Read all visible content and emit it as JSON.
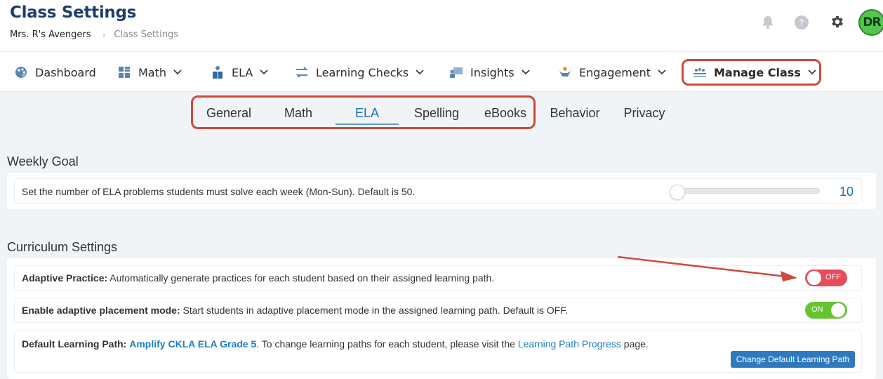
{
  "header": {
    "title": "Class Settings",
    "breadcrumb": {
      "class_name": "Mrs. R's Avengers",
      "separator": "›",
      "current": "Class Settings"
    },
    "help_glyph": "?",
    "avatar_initials": "DR"
  },
  "main_nav": {
    "items": [
      {
        "label": "Dashboard",
        "icon": "palette-icon"
      },
      {
        "label": "Math",
        "icon": "grid-icon"
      },
      {
        "label": "ELA",
        "icon": "reader-icon"
      },
      {
        "label": "Learning Checks",
        "icon": "swap-arrows-icon"
      },
      {
        "label": "Insights",
        "icon": "presentation-icon"
      },
      {
        "label": "Engagement",
        "icon": "hands-icon"
      },
      {
        "label": "Manage Class",
        "icon": "group-icon"
      }
    ]
  },
  "sub_tabs": {
    "items": [
      "General",
      "Math",
      "ELA",
      "Spelling",
      "eBooks",
      "Behavior",
      "Privacy"
    ],
    "active": "ELA"
  },
  "weekly_goal": {
    "title": "Weekly Goal",
    "description": "Set the number of ELA problems students must solve each week (Mon-Sun). Default is 50.",
    "value": "10"
  },
  "curriculum": {
    "title": "Curriculum Settings",
    "adaptive_practice": {
      "label": "Adaptive Practice:",
      "description": " Automatically generate practices for each student based on their assigned learning path.",
      "toggle": "OFF"
    },
    "placement_mode": {
      "label": "Enable adaptive placement mode:",
      "description": " Start students in adaptive placement mode in the assigned learning path. Default is OFF.",
      "toggle": "ON"
    },
    "default_path": {
      "label": "Default Learning Path:",
      "path_name": "Amplify CKLA ELA Grade 5",
      "text_before_link": ". To change learning paths for each student, please visit the ",
      "link_text": "Learning Path Progress",
      "text_after_link": " page.",
      "button_label": "Change Default Learning Path"
    }
  },
  "colors": {
    "title_navy": "#1f3d6b",
    "link_blue": "#1e7fbf",
    "toggle_off": "#e74c5a",
    "toggle_on": "#66c332",
    "annotation_red": "#cc4a3d",
    "avatar_green": "#53c44f"
  }
}
